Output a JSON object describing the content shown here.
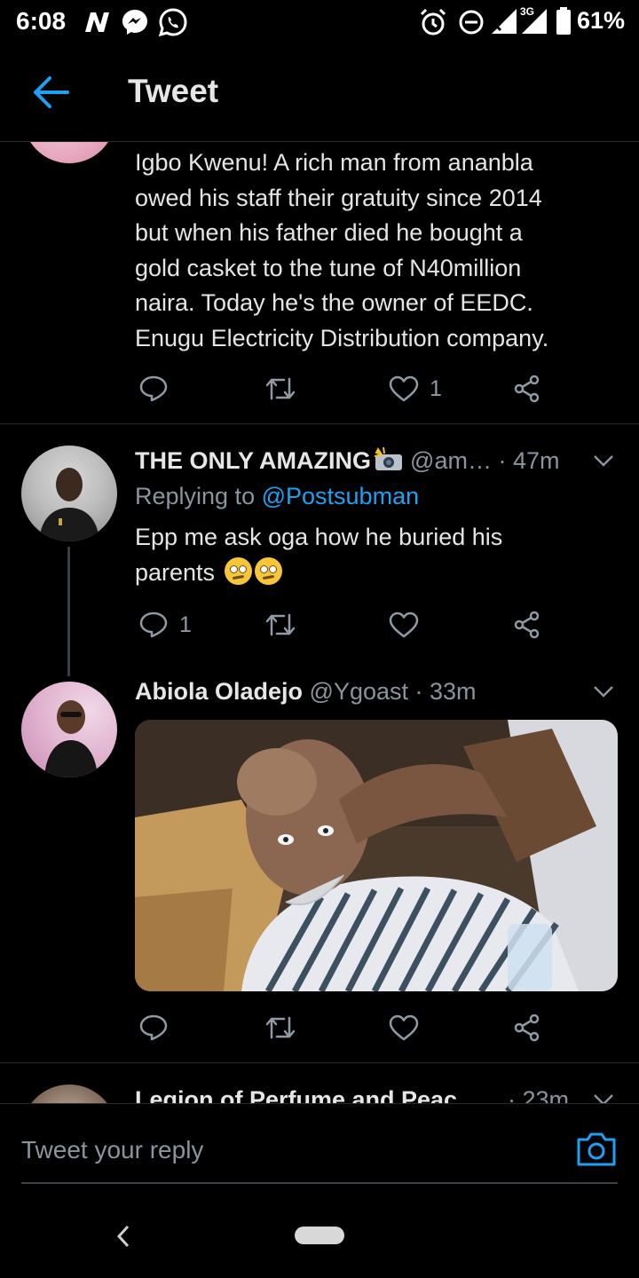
{
  "status_bar": {
    "time": "6:08",
    "network": "3G",
    "battery": "61%"
  },
  "header": {
    "title": "Tweet"
  },
  "tweets": [
    {
      "text_lines": [
        "Igbo Kwenu! A rich man from ananbla",
        "owed his staff their gratuity since 2014",
        "but when his father died he bought a",
        "gold casket to the tune of N40million",
        "naira. Today he's the owner of EEDC.",
        "Enugu Electricity Distribution company."
      ],
      "likes": "1"
    },
    {
      "name": "THE ONLY AMAZING",
      "handle": "@am…",
      "time": "· 47m",
      "replying_label": "Replying to",
      "replying_to": "@Postsubman",
      "text_lines": [
        "Epp me ask oga how he buried his",
        "parents"
      ],
      "replies": "1"
    },
    {
      "name": "Abiola Oladejo",
      "handle": "@Ygoast",
      "time": "· 33m"
    },
    {
      "name": "Legion of Perfume and Peac",
      "time": "· 23m"
    }
  ],
  "reply_bar": {
    "placeholder": "Tweet your reply"
  },
  "colors": {
    "background": "#000000",
    "accent": "#1da1f2",
    "muted": "#8a949e"
  },
  "icons": [
    "back-arrow-icon",
    "reply-icon",
    "retweet-icon",
    "like-icon",
    "share-icon",
    "chevron-down-icon",
    "camera-icon"
  ]
}
